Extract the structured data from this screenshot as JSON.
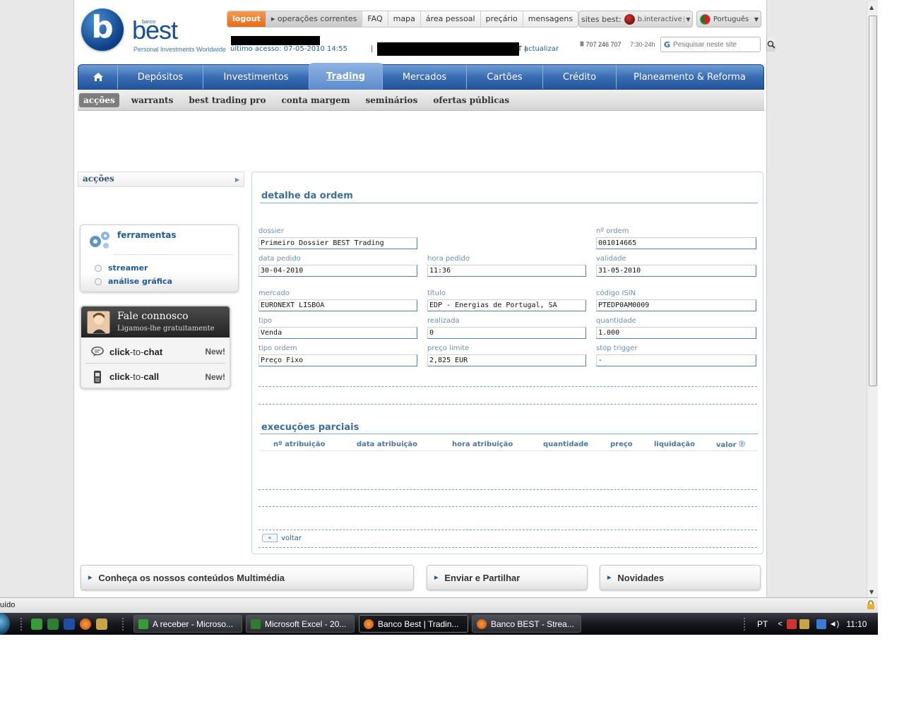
{
  "logo": {
    "letter": "b",
    "banco": "banco",
    "word": "best",
    "tagline": "Personal Investments Worldwide"
  },
  "topnav": [
    "logout",
    "▸ operações correntes",
    "FAQ",
    "mapa",
    "área pessoal",
    "preçário",
    "mensagens"
  ],
  "sites": {
    "label": "sites best:",
    "value": "b.interactive"
  },
  "language": "Português",
  "session": {
    "last_access": "último acesso: 07-05-2010 14:55",
    "separator": "|",
    "tail": "T |",
    "update": "actualizar"
  },
  "phone": {
    "number": "707 246 707",
    "hours": "7:30-24h"
  },
  "search": {
    "placeholder": "Pesquisar neste site"
  },
  "mainnav": [
    "Depósitos",
    "Investimentos",
    "Trading",
    "Mercados",
    "Cartões",
    "Crédito",
    "Planeamento & Reforma"
  ],
  "subnav": [
    "acções",
    "warrants",
    "best trading pro",
    "conta margem",
    "seminários",
    "ofertas públicas"
  ],
  "left": {
    "section": "acções",
    "tools_title": "ferramentas",
    "tools_links": [
      "streamer",
      "análise gráfica"
    ],
    "contact_title": "Fale connosco",
    "contact_sub": "Ligamos-lhe gratuitamente",
    "chat_a": "click",
    "chat_b": "-to-",
    "chat_c": "chat",
    "call_a": "click",
    "call_b": "-to-",
    "call_c": "call",
    "new_badge": "New!"
  },
  "order": {
    "title": "detalhe da ordem",
    "fields": {
      "dossier": {
        "label": "dossier",
        "value": "Primeiro Dossier BEST Trading"
      },
      "order_no": {
        "label": "nº ordem",
        "value": "001014665"
      },
      "date": {
        "label": "data pedido",
        "value": "30-04-2010"
      },
      "time": {
        "label": "hora pedido",
        "value": "11:36"
      },
      "validity": {
        "label": "validade",
        "value": "31-05-2010"
      },
      "market": {
        "label": "mercado",
        "value": "EURONEXT LISBOA"
      },
      "title": {
        "label": "título",
        "value": "EDP - Energias de Portugal, SA"
      },
      "isin": {
        "label": "código ISIN",
        "value": "PTEDP0AM0009"
      },
      "type": {
        "label": "tipo",
        "value": "Venda"
      },
      "executed": {
        "label": "realizada",
        "value": "0"
      },
      "quantity": {
        "label": "quantidade",
        "value": "1.000"
      },
      "order_type": {
        "label": "tipo ordem",
        "value": "Preço Fixo"
      },
      "limit_price": {
        "label": "preço limite",
        "value": "2,825 EUR"
      },
      "stop_trigger": {
        "label": "stop trigger",
        "value": "-"
      }
    },
    "partials_title": "execuções parciais",
    "partials_columns": [
      "nº atribuição",
      "data atribuição",
      "hora atribuição",
      "quantidade",
      "preço",
      "liquidação",
      "valor"
    ],
    "back": "voltar"
  },
  "bottom_boxes": [
    "Conheça os nossos conteúdos Multimédia",
    "Enviar e Partilhar",
    "Novidades"
  ],
  "statusbar": {
    "text": "uído"
  },
  "taskbar": {
    "tasks": [
      "A receber - Microso...",
      "Microsoft Excel - 20...",
      "Banco Best | Tradin...",
      "Banco BEST - Strea..."
    ],
    "lang": "PT",
    "clock": "11:10"
  },
  "colors": {
    "brand_blue": "#1a4f96",
    "nav_blue": "#3b6db3",
    "logout_orange": "#e46d1a",
    "label_blue": "#6b8fb3"
  }
}
